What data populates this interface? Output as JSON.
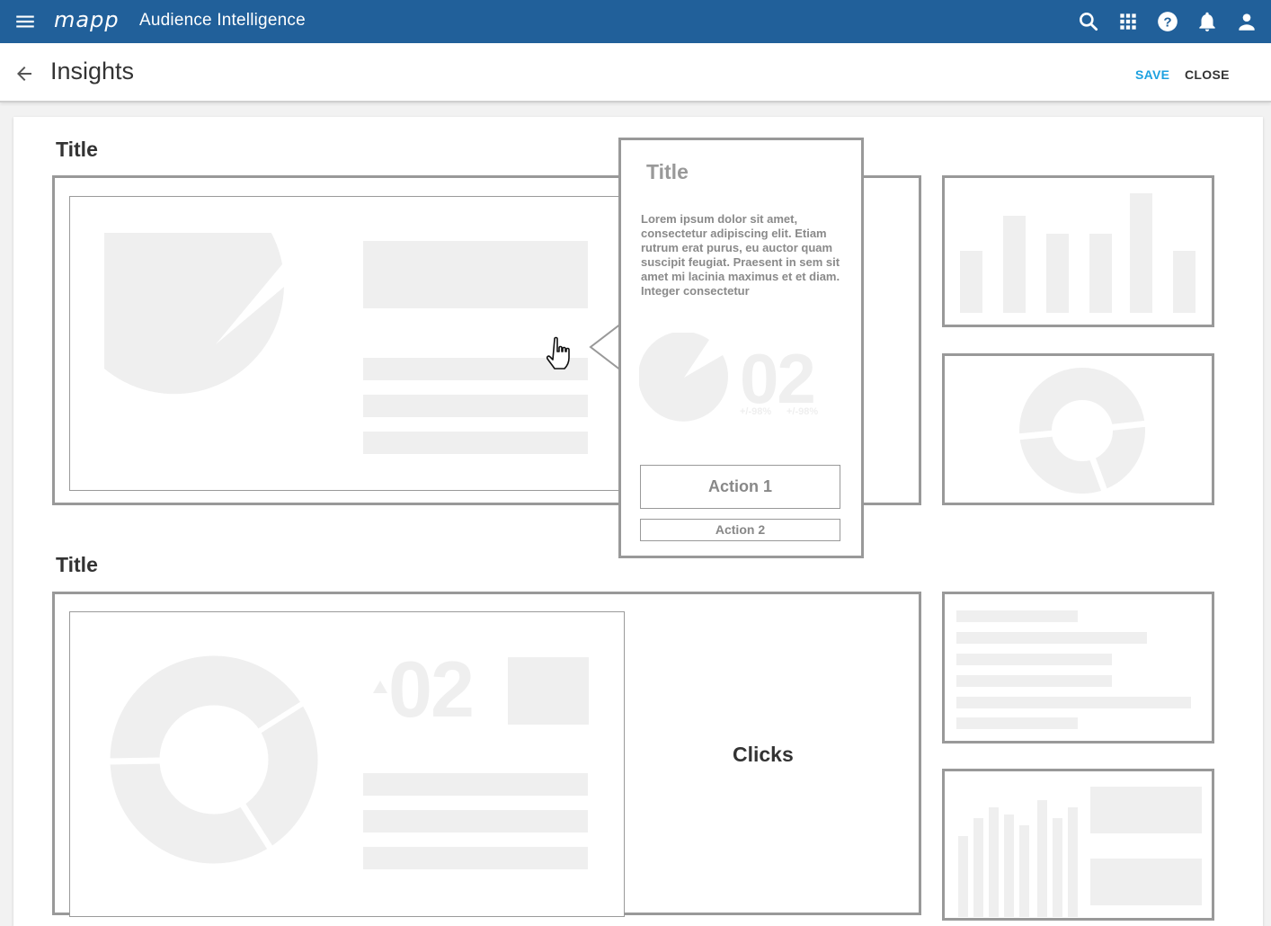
{
  "header": {
    "logo": "mapp",
    "app_title": "Audience Intelligence",
    "icons": [
      "menu-icon",
      "search-icon",
      "apps-grid-icon",
      "help-icon",
      "notifications-icon",
      "account-icon"
    ]
  },
  "subheader": {
    "page_title": "Insights",
    "save_label": "SAVE",
    "close_label": "CLOSE"
  },
  "colors": {
    "topbar": "#21609a",
    "save": "#1da1e0",
    "frame": "#999999",
    "placeholder": "#efefef"
  },
  "sections": [
    {
      "title": "Title"
    },
    {
      "title": "Title",
      "big_number": "02",
      "side_label": "Clicks"
    }
  ],
  "popover": {
    "title": "Title",
    "body": "Lorem ipsum dolor sit amet, consectetur adipiscing elit. Etiam rutrum erat purus, eu auctor quam suscipit feugiat. Praesent in sem sit amet mi lacinia maximus et et diam. Integer consectetur",
    "big_number": "02",
    "change_a": "+/-98%",
    "change_b": "+/-98%",
    "action1": "Action 1",
    "action2": "Action 2"
  }
}
